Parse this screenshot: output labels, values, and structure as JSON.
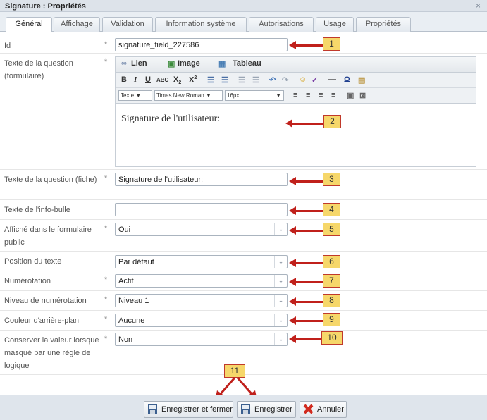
{
  "window": {
    "title": "Signature : Propriétés",
    "close": "×"
  },
  "tabs": [
    "Général",
    "Affichage",
    "Validation",
    "Information système",
    "Autorisations",
    "Usage",
    "Propriétés"
  ],
  "fields": {
    "id": {
      "label": "Id",
      "value": "signature_field_227586"
    },
    "question_form": {
      "label": "Texte de la question (formulaire)"
    },
    "question_sheet": {
      "label": "Texte de la question (fiche)",
      "value": "Signature de l'utilisateur:"
    },
    "tooltip": {
      "label": "Texte de l'info-bulle",
      "value": ""
    },
    "public": {
      "label": "Affiché dans le formulaire public",
      "value": "Oui"
    },
    "position": {
      "label": "Position du texte",
      "value": "Par défaut"
    },
    "numbering": {
      "label": "Numérotation",
      "value": "Actif"
    },
    "level": {
      "label": "Niveau de numérotation",
      "value": "Niveau 1"
    },
    "bgcolor": {
      "label": "Couleur d'arrière-plan",
      "value": "Aucune"
    },
    "keep": {
      "label": "Conserver la valeur lorsque masqué par une règle de logique",
      "value": "Non"
    }
  },
  "required_mark": "*",
  "editor": {
    "tabs": [
      "Lien",
      "Image",
      "Tableau"
    ],
    "format": "Texte",
    "font": "Times New Roman",
    "size": "16px",
    "content": "Signature de l'utilisateur:"
  },
  "callouts": [
    "1",
    "2",
    "3",
    "4",
    "5",
    "6",
    "7",
    "8",
    "9",
    "10",
    "11"
  ],
  "buttons": {
    "save_close": "Enregistrer et fermer",
    "save": "Enregistrer",
    "cancel": "Annuler"
  },
  "colors": {
    "accent_red": "#c0201b",
    "callout_fill": "#f6d76a",
    "titlebar": "#dde3ea"
  }
}
